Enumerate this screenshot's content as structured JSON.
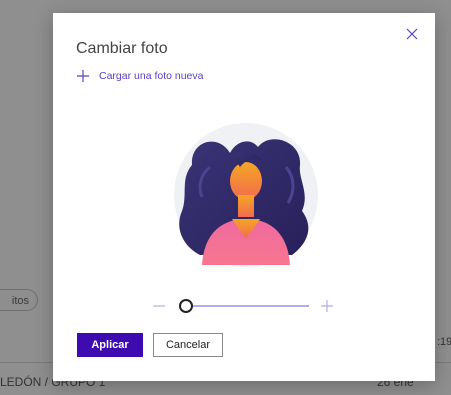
{
  "background": {
    "chip_text": "itos",
    "time_text": ":19",
    "row_left_text": "LEDÓN / GRUPO 1",
    "row_right_text": "26 ene"
  },
  "dialog": {
    "title": "Cambiar foto",
    "upload_label": "Cargar una foto nueva",
    "apply_label": "Aplicar",
    "cancel_label": "Cancelar",
    "zoom_level": 0.05,
    "accent_color": "#3d0bb0",
    "link_color": "#5b3fc4"
  }
}
